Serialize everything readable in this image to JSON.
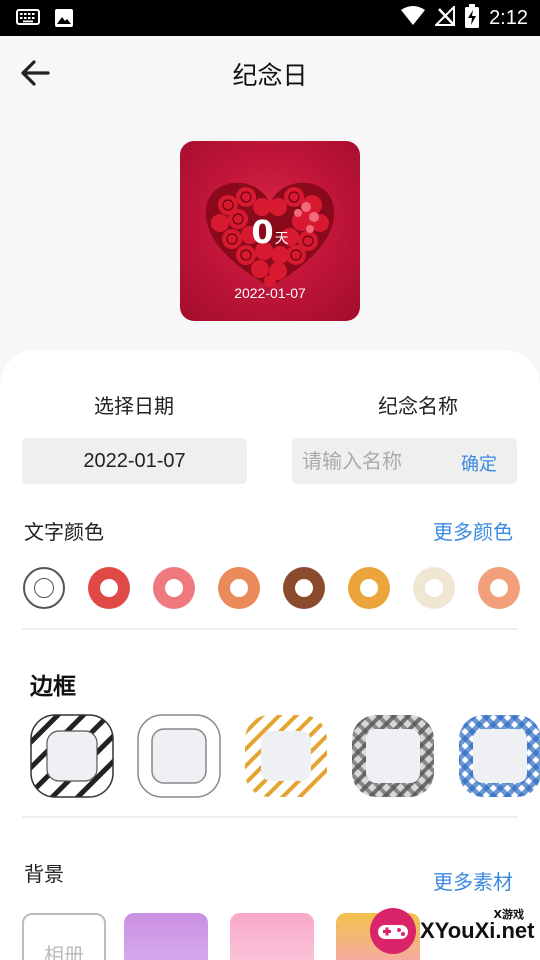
{
  "status_bar": {
    "time": "2:12"
  },
  "header": {
    "title": "纪念日"
  },
  "preview": {
    "days": "0",
    "unit": "天",
    "date": "2022-01-07"
  },
  "form": {
    "date_label": "选择日期",
    "name_label": "纪念名称",
    "date_value": "2022-01-07",
    "name_placeholder": "请输入名称",
    "confirm_label": "确定"
  },
  "text_color": {
    "label": "文字颜色",
    "more_label": "更多颜色",
    "swatches": [
      "#ffffff",
      "#e04a46",
      "#ee7a80",
      "#ea8a5a",
      "#8a4a2c",
      "#eca53a",
      "#efe7d4",
      "#f2a07a"
    ]
  },
  "border": {
    "heading": "边框"
  },
  "background": {
    "label": "背景",
    "more_label": "更多素材",
    "album_label": "相册"
  },
  "watermark": {
    "small": "X游戏",
    "big": "XYouXi.net"
  }
}
